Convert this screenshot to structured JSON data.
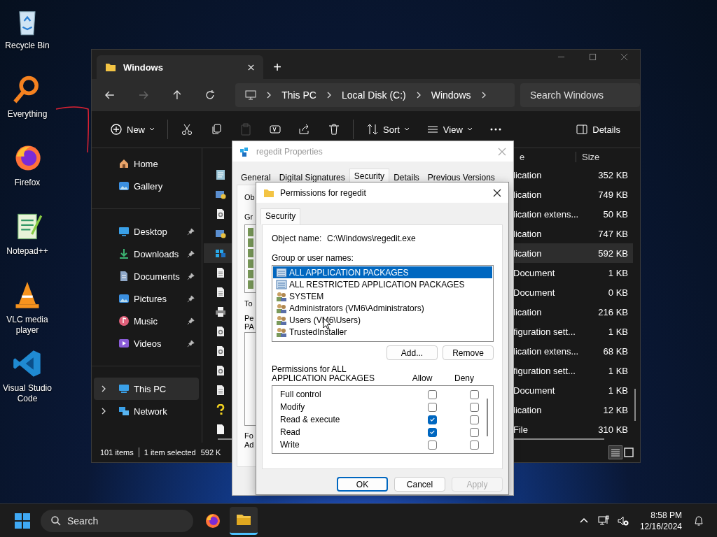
{
  "desktop_icons": [
    {
      "label": "Recycle Bin",
      "kind": "recycle"
    },
    {
      "label": "Everything",
      "kind": "magnifier"
    },
    {
      "label": "Firefox",
      "kind": "firefox"
    },
    {
      "label": "Notepad++",
      "kind": "notepad"
    },
    {
      "label": "VLC media player",
      "kind": "vlc"
    },
    {
      "label": "Visual Studio Code",
      "kind": "vscode"
    }
  ],
  "explorer": {
    "tab_title": "Windows",
    "new_tab": "+",
    "breadcrumb": [
      "This PC",
      "Local Disk (C:)",
      "Windows"
    ],
    "search": {
      "placeholder": "Search Windows"
    },
    "commands": [
      {
        "kind": "new",
        "label": "New",
        "disabled": false
      },
      {
        "kind": "cut",
        "disabled": false
      },
      {
        "kind": "copy",
        "disabled": false
      },
      {
        "kind": "paste",
        "disabled": true
      },
      {
        "kind": "rename",
        "disabled": false
      },
      {
        "kind": "share",
        "disabled": false
      },
      {
        "kind": "delete",
        "disabled": false
      },
      {
        "kind": "sort",
        "label": "Sort",
        "disabled": false
      },
      {
        "kind": "view",
        "label": "View",
        "disabled": false
      },
      {
        "kind": "more",
        "disabled": false
      },
      {
        "kind": "details",
        "label": "Details",
        "disabled": false
      }
    ],
    "sidebar": {
      "groups": [
        {
          "items": [
            {
              "label": "Home",
              "kind": "home",
              "pinned": false,
              "expandable": false,
              "selected": false
            },
            {
              "label": "Gallery",
              "kind": "gallery",
              "pinned": false,
              "expandable": false,
              "selected": false
            }
          ]
        },
        {
          "items": [
            {
              "label": "Desktop",
              "kind": "desktop",
              "pinned": true,
              "expandable": false,
              "selected": false
            },
            {
              "label": "Downloads",
              "kind": "downloads",
              "pinned": true,
              "expandable": false,
              "selected": false
            },
            {
              "label": "Documents",
              "kind": "documents",
              "pinned": true,
              "expandable": false,
              "selected": false
            },
            {
              "label": "Pictures",
              "kind": "pictures",
              "pinned": true,
              "expandable": false,
              "selected": false
            },
            {
              "label": "Music",
              "kind": "music",
              "pinned": true,
              "expandable": false,
              "selected": false
            },
            {
              "label": "Videos",
              "kind": "videos",
              "pinned": true,
              "expandable": false,
              "selected": false
            }
          ]
        },
        {
          "items": [
            {
              "label": "This PC",
              "kind": "pc",
              "pinned": false,
              "expandable": true,
              "selected": true
            },
            {
              "label": "Network",
              "kind": "network",
              "pinned": false,
              "expandable": true,
              "selected": false
            }
          ]
        }
      ]
    },
    "table": {
      "columns": {
        "column_1": "e",
        "size": "Size"
      },
      "rows": [
        {
          "kind": "notepad",
          "type": "lication",
          "size": "352 KB",
          "selected": false
        },
        {
          "kind": "app",
          "type": "lication",
          "size": "749 KB",
          "selected": false
        },
        {
          "kind": "dll",
          "type": "lication extens...",
          "size": "50 KB",
          "selected": false
        },
        {
          "kind": "app",
          "type": "lication",
          "size": "747 KB",
          "selected": false
        },
        {
          "kind": "registry",
          "type": "lication",
          "size": "592 KB",
          "selected": true
        },
        {
          "kind": "text",
          "type": "Document",
          "size": "1 KB",
          "selected": false
        },
        {
          "kind": "text",
          "type": "Document",
          "size": "0 KB",
          "selected": false
        },
        {
          "kind": "printer",
          "type": "lication",
          "size": "216 KB",
          "selected": false
        },
        {
          "kind": "config",
          "type": "figuration sett...",
          "size": "1 KB",
          "selected": false
        },
        {
          "kind": "dll",
          "type": "lication extens...",
          "size": "68 KB",
          "selected": false
        },
        {
          "kind": "config",
          "type": "figuration sett...",
          "size": "1 KB",
          "selected": false
        },
        {
          "kind": "text",
          "type": "Document",
          "size": "1 KB",
          "selected": false
        },
        {
          "kind": "help",
          "type": "lication",
          "size": "12 KB",
          "selected": false
        },
        {
          "kind": "file",
          "type": "File",
          "size": "310 KB",
          "selected": false
        }
      ]
    },
    "status_bar": {
      "items": "101 items",
      "selection": "1 item selected",
      "size": "592 K"
    },
    "views": [
      {
        "kind": "details",
        "selected": true
      },
      {
        "kind": "tiles",
        "selected": false
      }
    ]
  },
  "properties": {
    "title": "regedit Properties",
    "tabs": [
      {
        "label": "General",
        "selected": false
      },
      {
        "label": "Digital Signatures",
        "selected": false
      },
      {
        "label": "Security",
        "selected": true
      },
      {
        "label": "Details",
        "selected": false
      },
      {
        "label": "Previous Versions",
        "selected": false
      }
    ],
    "visible_labels": {
      "object": "Ob",
      "group": "Gr",
      "to": "To",
      "perm_1": "Pe",
      "perm_2": "PA",
      "for": "Fo",
      "adv": "Ad"
    }
  },
  "permissions": {
    "title": "Permissions for regedit",
    "tab": {
      "label": "Security",
      "selected": true
    },
    "object_label": "Object name:",
    "object_value": "C:\\Windows\\regedit.exe",
    "group_label": "Group or user names:",
    "groups": [
      {
        "name": "ALL APPLICATION PACKAGES",
        "kind": "package",
        "selected": true
      },
      {
        "name": "ALL RESTRICTED APPLICATION PACKAGES",
        "kind": "package",
        "selected": false
      },
      {
        "name": "SYSTEM",
        "kind": "users",
        "selected": false
      },
      {
        "name": "Administrators (VM6\\Administrators)",
        "kind": "users",
        "selected": false
      },
      {
        "name": "Users (VM6\\Users)",
        "kind": "users",
        "selected": false
      },
      {
        "name": "TrustedInstaller",
        "kind": "users",
        "selected": false
      }
    ],
    "add_button": "Add...",
    "remove_button": "Remove",
    "perm_label": "Permissions for ALL APPLICATION PACKAGES",
    "allow_label": "Allow",
    "deny_label": "Deny",
    "perms": [
      {
        "name": "Full control",
        "allow": false,
        "deny": false
      },
      {
        "name": "Modify",
        "allow": false,
        "deny": false
      },
      {
        "name": "Read & execute",
        "allow": true,
        "deny": false
      },
      {
        "name": "Read",
        "allow": true,
        "deny": false
      },
      {
        "name": "Write",
        "allow": false,
        "deny": false
      }
    ],
    "buttons": [
      {
        "label": "OK",
        "kind": "default",
        "disabled": false
      },
      {
        "label": "Cancel",
        "kind": "normal",
        "disabled": false
      },
      {
        "label": "Apply",
        "kind": "normal",
        "disabled": true
      }
    ]
  },
  "taskbar": {
    "search": {
      "placeholder": "Search"
    },
    "apps": [
      {
        "kind": "firefox",
        "active": false
      },
      {
        "kind": "explorer",
        "active": true
      }
    ],
    "time": "8:58 PM",
    "date": "12/16/2024"
  }
}
